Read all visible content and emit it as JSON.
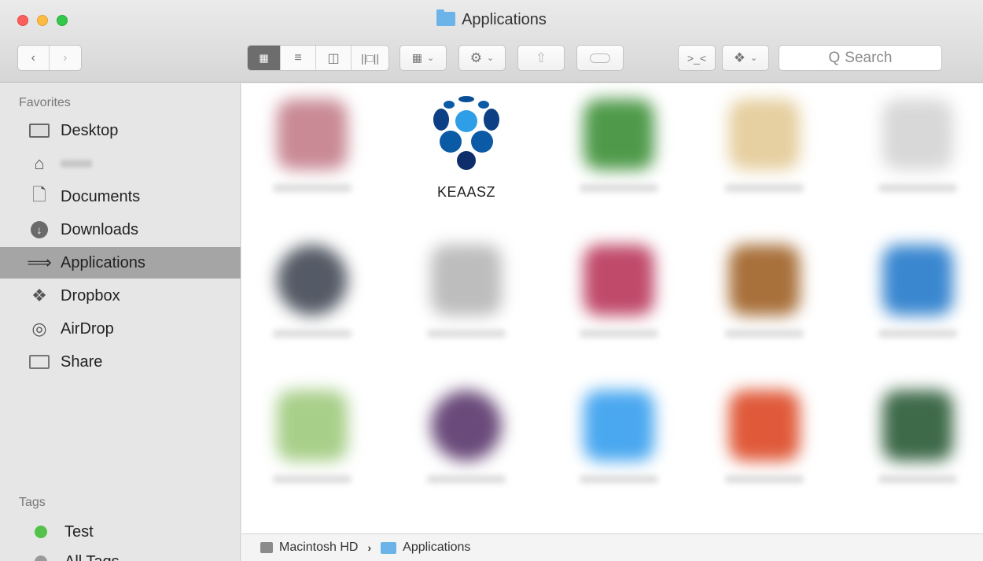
{
  "window": {
    "title": "Applications"
  },
  "toolbar": {
    "back_icon": "chevron-left-icon",
    "forward_icon": "chevron-right-icon",
    "view_modes": [
      "icon-view",
      "list-view",
      "column-view",
      "cover-flow-view"
    ],
    "active_view": "icon-view",
    "search_placeholder": "Search",
    "search_prefix": "Q"
  },
  "sidebar": {
    "favorites_heading": "Favorites",
    "items": [
      {
        "label": "Desktop",
        "icon": "desktop-icon"
      },
      {
        "label": "",
        "icon": "home-icon"
      },
      {
        "label": "Documents",
        "icon": "documents-icon"
      },
      {
        "label": "Downloads",
        "icon": "downloads-icon"
      },
      {
        "label": "Applications",
        "icon": "applications-icon",
        "selected": true
      },
      {
        "label": "Dropbox",
        "icon": "dropbox-icon"
      },
      {
        "label": "AirDrop",
        "icon": "airdrop-icon"
      },
      {
        "label": "Share",
        "icon": "folder-icon"
      }
    ],
    "tags_heading": "Tags",
    "tags": [
      {
        "label": "Test",
        "color": "#52c24a"
      },
      {
        "label": "All Tags...",
        "color": "#9a9a9a"
      }
    ]
  },
  "content": {
    "selected_app": {
      "label": "KEAASZ",
      "icon": "keaasz-app-icon"
    }
  },
  "pathbar": {
    "segments": [
      {
        "label": "Macintosh HD",
        "icon": "hard-drive-icon"
      },
      {
        "label": "Applications",
        "icon": "folder-icon"
      }
    ],
    "separator": "›"
  },
  "colors": {
    "folder_blue": "#6cb3ea",
    "selection_gray": "#a5a5a5",
    "logo_dark": "#0d2d6b",
    "logo_mid": "#0a5aa6",
    "logo_light": "#2e9fe6"
  }
}
